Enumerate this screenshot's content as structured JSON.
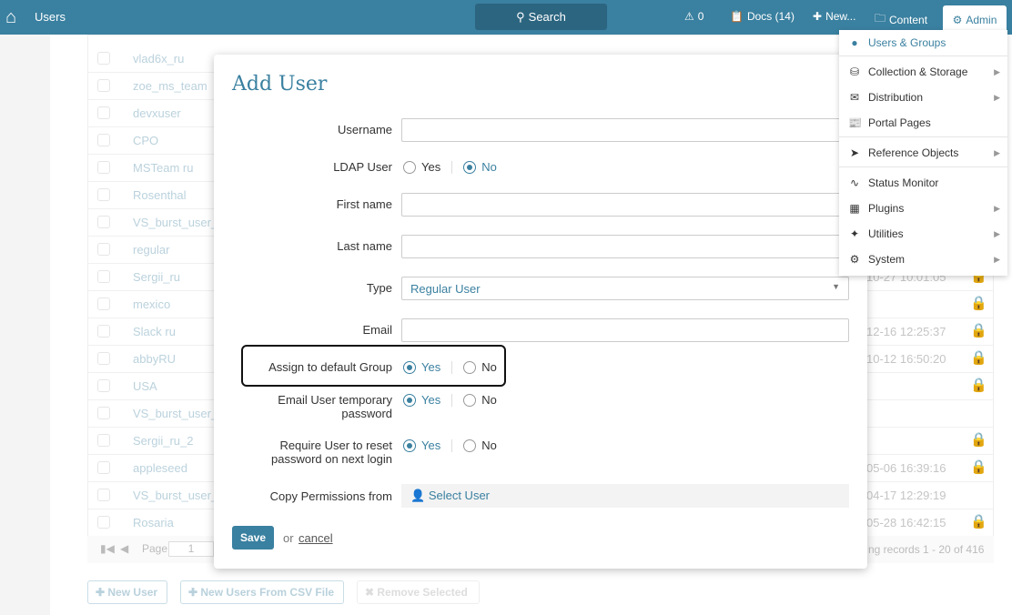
{
  "topbar": {
    "title": "Users",
    "search": "Search",
    "alerts": "0",
    "docs": "Docs (14)",
    "new": "New...",
    "content": "Content",
    "admin": "Admin"
  },
  "table": {
    "rows": [
      {
        "name": "vlad6x_ru",
        "date": "",
        "lock": false
      },
      {
        "name": "zoe_ms_team",
        "date": "",
        "lock": false
      },
      {
        "name": "devxuser",
        "date": "",
        "lock": false
      },
      {
        "name": "CPO",
        "date": "",
        "lock": false
      },
      {
        "name": "MSTeam ru",
        "date": "",
        "lock": false
      },
      {
        "name": "Rosenthal",
        "date": "",
        "lock": false
      },
      {
        "name": "VS_burst_user_",
        "date": "",
        "lock": false
      },
      {
        "name": "regular",
        "date": "",
        "lock": false
      },
      {
        "name": "Sergii_ru",
        "date": "10-27 10:01:05",
        "lock": true
      },
      {
        "name": "mexico",
        "date": "",
        "lock": true
      },
      {
        "name": "Slack ru",
        "date": "12-16 12:25:37",
        "lock": true
      },
      {
        "name": "abbyRU",
        "date": "10-12 16:50:20",
        "lock": true
      },
      {
        "name": "USA",
        "date": "",
        "lock": true
      },
      {
        "name": "VS_burst_user_",
        "date": "",
        "lock": false
      },
      {
        "name": "Sergii_ru_2",
        "date": "",
        "lock": true
      },
      {
        "name": "appleseed",
        "date": "05-06 16:39:16",
        "lock": true
      },
      {
        "name": "VS_burst_user_",
        "date": "04-17 12:29:19",
        "lock": false
      },
      {
        "name": "Rosaria",
        "date": "05-28 16:42:15",
        "lock": true
      }
    ],
    "pager": {
      "page_label": "Page",
      "page": "1",
      "records": "ng records 1 - 20 of 416"
    }
  },
  "buttons": {
    "new_user": "New User",
    "csv": "New Users From CSV File",
    "remove": "Remove Selected"
  },
  "modal": {
    "title": "Add User",
    "username": "Username",
    "ldap": "LDAP User",
    "first": "First name",
    "last": "Last name",
    "type": "Type",
    "type_value": "Regular User",
    "email": "Email",
    "assign": "Assign to default Group",
    "email_temp": "Email User temporary password",
    "reset": "Require User to reset password on next login",
    "copy": "Copy Permissions from",
    "select_user": "Select User",
    "yes": "Yes",
    "no": "No",
    "save": "Save",
    "or": "or",
    "cancel": "cancel"
  },
  "menu": {
    "items": [
      "Users & Groups",
      "Collection & Storage",
      "Distribution",
      "Portal Pages",
      "Reference Objects",
      "Status Monitor",
      "Plugins",
      "Utilities",
      "System"
    ]
  }
}
